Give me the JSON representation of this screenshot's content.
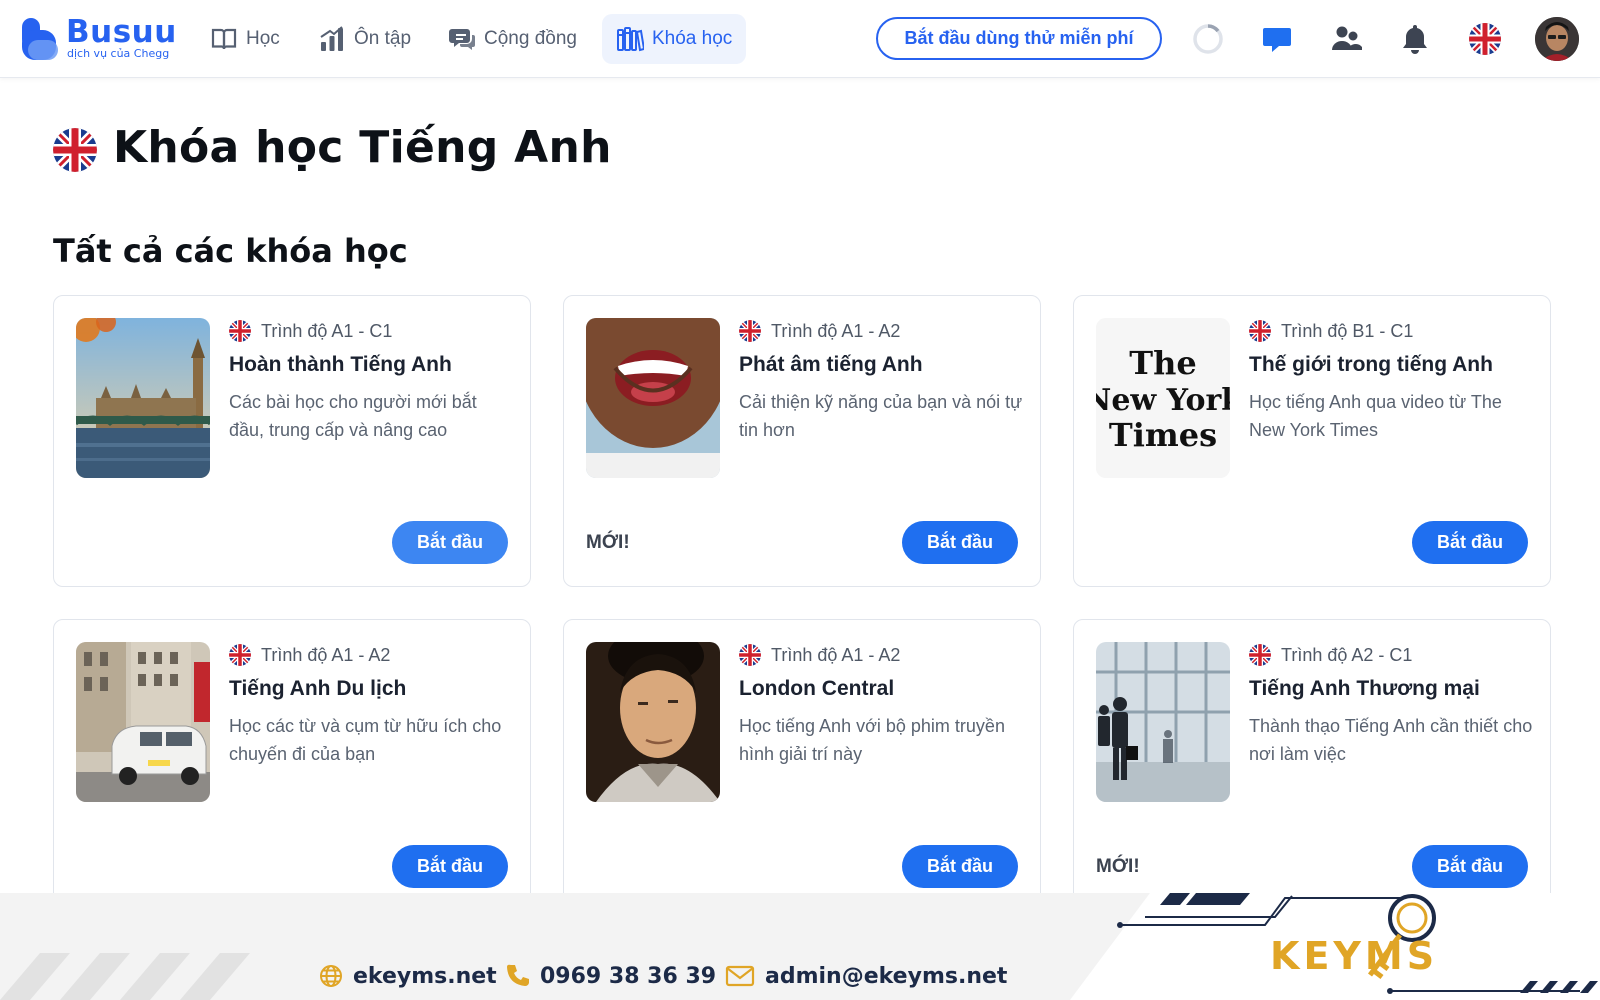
{
  "brand": {
    "name": "Busuu",
    "tagline": "dịch vụ của Chegg"
  },
  "nav": {
    "items": [
      {
        "label": "Học",
        "icon": "book-icon"
      },
      {
        "label": "Ôn tập",
        "icon": "bar-chart-icon"
      },
      {
        "label": "Cộng đồng",
        "icon": "chat-icon"
      },
      {
        "label": "Khóa học",
        "icon": "library-icon",
        "active": true
      }
    ],
    "trial_button": "Bắt đầu dùng thử miễn phí"
  },
  "page": {
    "title": "Khóa học Tiếng Anh",
    "section_title": "Tất cả các khóa học"
  },
  "courses": [
    {
      "level": "Trình độ A1 - C1",
      "title": "Hoàn thành Tiếng Anh",
      "description": "Các bài học cho người mới bắt đầu, trung cấp và nâng cao",
      "button": "Bắt đầu",
      "badge": ""
    },
    {
      "level": "Trình độ A1 - A2",
      "title": "Phát âm tiếng Anh",
      "description": "Cải thiện kỹ năng của bạn và nói tự tin hơn",
      "button": "Bắt đầu",
      "badge": "MỚI!"
    },
    {
      "level": "Trình độ B1 - C1",
      "title": "Thế giới trong tiếng Anh",
      "description": "Học tiếng Anh qua video từ The New York Times",
      "button": "Bắt đầu",
      "badge": "",
      "thumb_text": [
        "The",
        "New York",
        "Times"
      ]
    },
    {
      "level": "Trình độ A1 - A2",
      "title": "Tiếng Anh Du lịch",
      "description": "Học các từ và cụm từ hữu ích cho chuyến đi của bạn",
      "button": "Bắt đầu",
      "badge": ""
    },
    {
      "level": "Trình độ A1 - A2",
      "title": "London Central",
      "description": "Học tiếng Anh với bộ phim truyền hình giải trí này",
      "button": "Bắt đầu",
      "badge": ""
    },
    {
      "level": "Trình độ A2 - C1",
      "title": "Tiếng Anh Thương mại",
      "description": "Thành thạo Tiếng Anh cần thiết cho nơi làm việc",
      "button": "Bắt đầu",
      "badge": "MỚI!"
    }
  ],
  "footer": {
    "website": "ekeyms.net",
    "phone": "0969 38 36 39",
    "email": "admin@ekeyms.net",
    "logo_text": "KEYMS"
  },
  "colors": {
    "primary": "#1f6ff0",
    "brand_blue": "#2762f0",
    "nav_active_bg": "#eef3fd",
    "footer_navy": "#1c2a47",
    "footer_gold": "#e0a526"
  }
}
